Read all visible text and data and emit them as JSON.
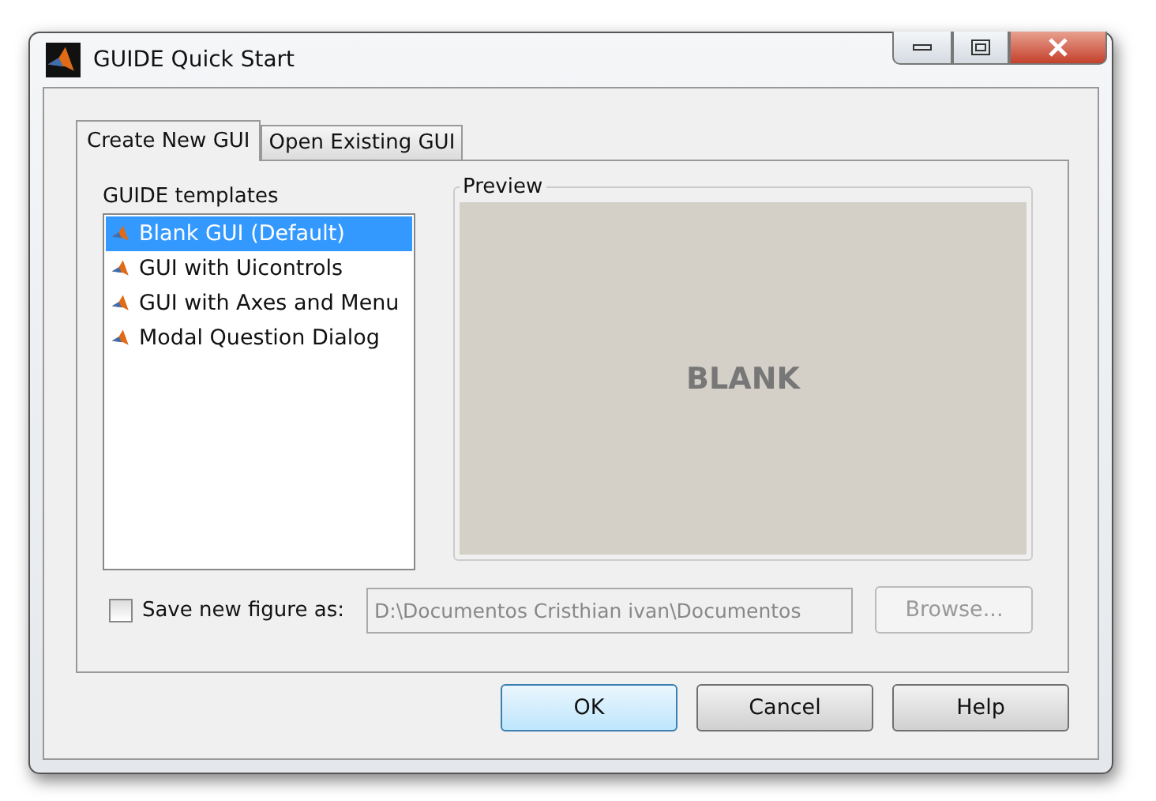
{
  "window": {
    "title": "GUIDE Quick Start"
  },
  "tabs": [
    {
      "label": "Create New GUI",
      "selected": true
    },
    {
      "label": "Open Existing GUI",
      "selected": false
    }
  ],
  "templates": {
    "label": "GUIDE templates",
    "items": [
      {
        "label": "Blank GUI (Default)",
        "selected": true
      },
      {
        "label": "GUI with Uicontrols",
        "selected": false
      },
      {
        "label": "GUI with Axes and Menu",
        "selected": false
      },
      {
        "label": "Modal Question Dialog",
        "selected": false
      }
    ]
  },
  "preview": {
    "title": "Preview",
    "text": "BLANK"
  },
  "save": {
    "label": "Save new figure as:",
    "checked": false,
    "value": "D:\\Documentos Cristhian ivan\\Documentos",
    "disabled": true
  },
  "browse": {
    "label": "Browse...",
    "disabled": true
  },
  "buttons": [
    {
      "label": "OK",
      "default": true
    },
    {
      "label": "Cancel",
      "default": false
    },
    {
      "label": "Help",
      "default": false
    }
  ]
}
